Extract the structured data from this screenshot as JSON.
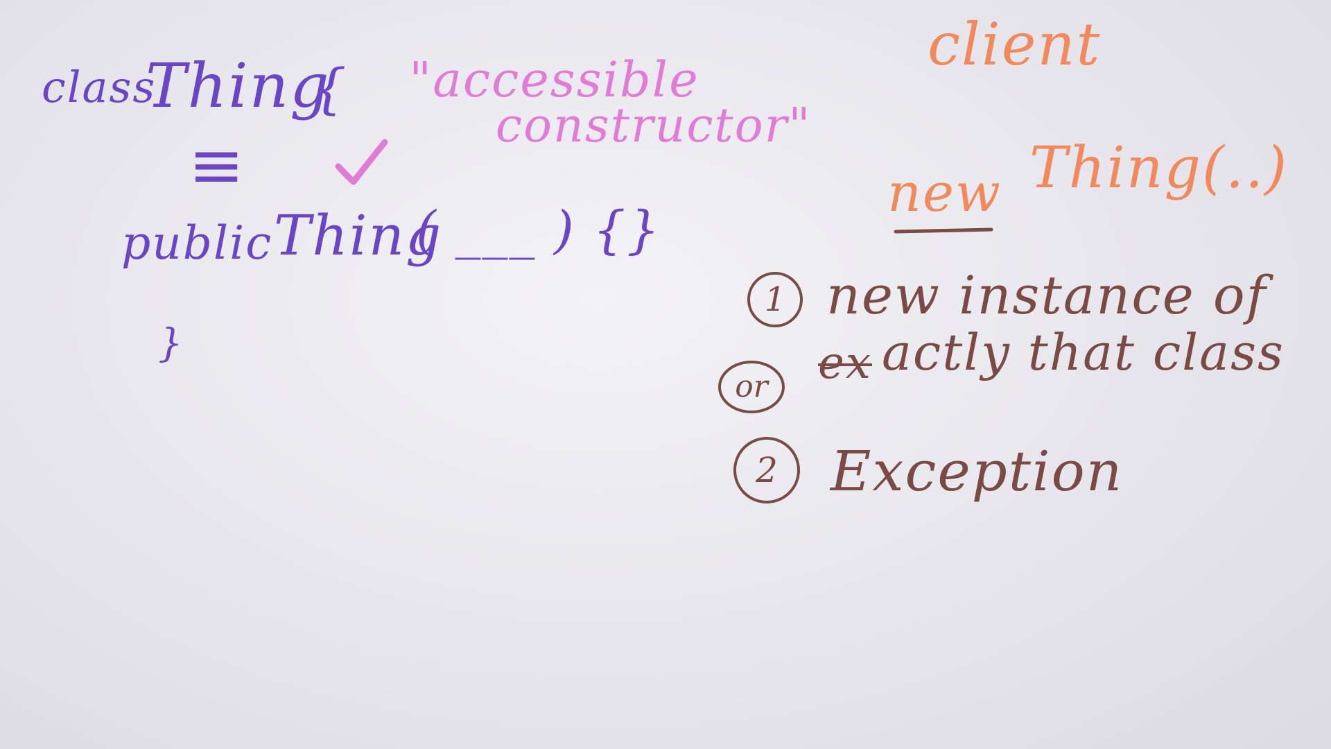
{
  "whiteboard": {
    "left": {
      "class_word": "class",
      "class_name": "Thing",
      "open_brace": "{",
      "equiv_symbol": "≡",
      "public_keyword": "public",
      "ctor_name": "Thing",
      "ctor_params": "( ___ ) {}",
      "close_brace": "}"
    },
    "annotation": {
      "line1": "\"accessible",
      "line2": "constructor\""
    },
    "right": {
      "client_label": "client",
      "new_keyword": "new",
      "new_call": "Thing(..)",
      "item1_number": "1",
      "item1_line1": "new instance of",
      "item1_struck": "ex",
      "item1_line2": "actly that class",
      "or_label": "or",
      "item2_number": "2",
      "item2_text": "Exception"
    },
    "colors": {
      "purple_marker": "#6a45c4",
      "pink_marker": "#e07bd6",
      "orange_marker": "#f08a5c",
      "brown_marker": "#7a4a44",
      "board": "#ececf1"
    }
  }
}
